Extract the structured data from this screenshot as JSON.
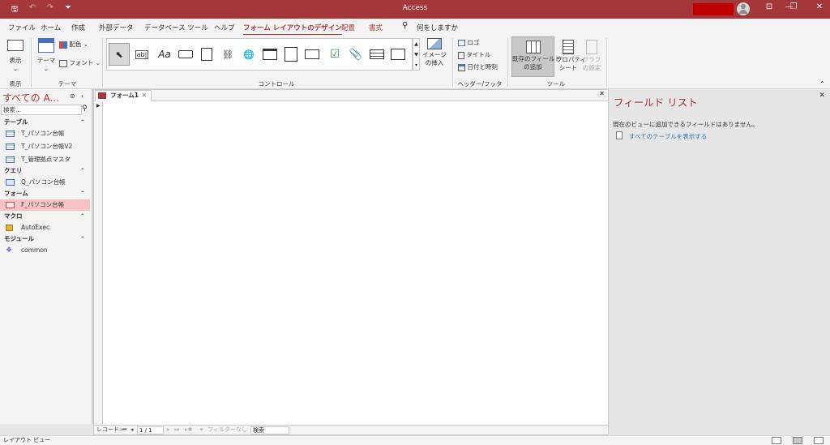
{
  "window": {
    "title": "Access",
    "qat": [
      "save-icon",
      "undo-icon",
      "redo-icon",
      "customize-icon"
    ],
    "controls": {
      "minimize": "—",
      "restore": "❐",
      "close": "✕",
      "ribbon_display": "⊡"
    }
  },
  "tabs": {
    "file": "ファイル",
    "home": "ホーム",
    "create": "作成",
    "external": "外部データ",
    "dbtools": "データベース ツール",
    "help": "ヘルプ",
    "form_layout_design": "フォーム レイアウトのデザイン",
    "arrange": "配置",
    "format": "書式",
    "tell_me": "何をしますか"
  },
  "ribbon": {
    "view": {
      "label": "表示",
      "group": "表示"
    },
    "theme": {
      "theme": "テーマ",
      "colors": "配色",
      "fonts": "フォント",
      "group": "テーマ"
    },
    "controls": {
      "group": "コントロール",
      "insert_image": "イメージ\nの挿入",
      "items": [
        "select",
        "textbox",
        "label",
        "button",
        "tab-control",
        "hyperlink",
        "web-browser",
        "navigation",
        "option-group",
        "page-break",
        "combo-box",
        "checkbox",
        "attachment",
        "list-box",
        "chart"
      ]
    },
    "header_footer": {
      "logo": "ロゴ",
      "title": "タイトル",
      "datetime": "日付と時刻",
      "group": "ヘッダー/フッター"
    },
    "tools": {
      "add_existing": "既存のフィールド\nの追加",
      "property_sheet": "プロパティ\nシート",
      "chart_settings": "グラフ\nの設定",
      "group": "ツール"
    }
  },
  "nav": {
    "title": "すべての A...",
    "search_placeholder": "検索...",
    "sections": [
      {
        "label": "テーブル",
        "items": [
          "T_パソコン台帳",
          "T_パソコン台帳V2",
          "T_管理拠点マスタ"
        ]
      },
      {
        "label": "クエリ",
        "items": [
          "Q_パソコン台帳"
        ]
      },
      {
        "label": "フォーム",
        "items": [
          "F_パソコン台帳"
        ]
      },
      {
        "label": "マクロ",
        "items": [
          "AutoExec"
        ]
      },
      {
        "label": "モジュール",
        "items": [
          "common"
        ]
      }
    ]
  },
  "document": {
    "tab_label": "フォーム1",
    "record_nav": {
      "label": "レコード:",
      "position": "1 / 1",
      "filter": "フィルターなし",
      "search": "検索"
    }
  },
  "field_list": {
    "title": "フィールド リスト",
    "message": "現在のビューに追加できるフィールドはありません。",
    "show_all_link": "すべてのテーブルを表示する"
  },
  "status": {
    "text": "レイアウト ビュー"
  },
  "colors": {
    "accent": "#a4373a",
    "selected_nav": "#f6c2c3"
  }
}
